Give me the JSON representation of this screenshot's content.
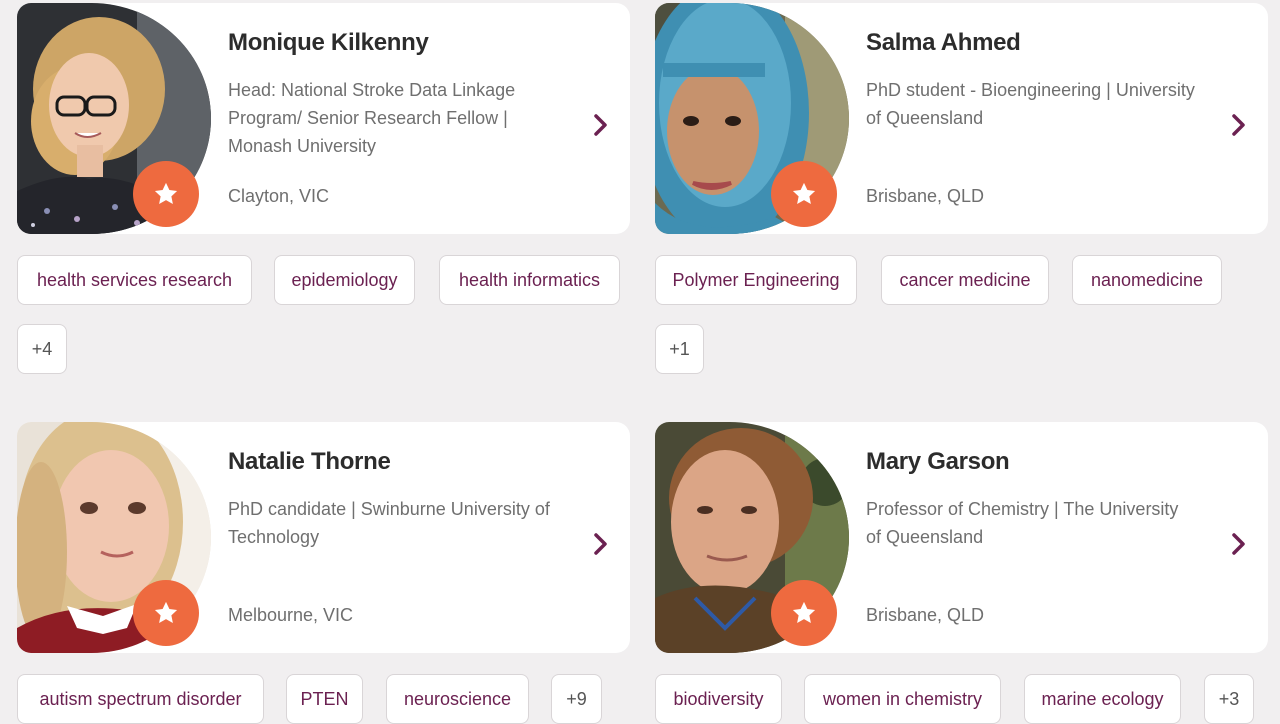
{
  "profiles": [
    {
      "name": "Monique Kilkenny",
      "role": "Head: National Stroke Data Linkage Program/ Senior Research Fellow | Monash University",
      "location": "Clayton, VIC",
      "tags": [
        "health services research",
        "epidemiology",
        "health informatics"
      ],
      "more": "+4"
    },
    {
      "name": "Salma Ahmed",
      "role": "PhD student - Bioengineering | University of Queensland",
      "location": "Brisbane, QLD",
      "tags": [
        "Polymer Engineering",
        "cancer medicine",
        "nanomedicine"
      ],
      "more": "+1"
    },
    {
      "name": "Natalie Thorne",
      "role": "PhD candidate | Swinburne University of Technology",
      "location": "Melbourne, VIC",
      "tags": [
        "autism spectrum disorder",
        "PTEN",
        "neuroscience"
      ],
      "more": "+9"
    },
    {
      "name": "Mary Garson",
      "role": "Professor of Chemistry | The University of Queensland",
      "location": "Brisbane, QLD",
      "tags": [
        "biodiversity",
        "women in chemistry",
        "marine ecology"
      ],
      "more": "+3"
    }
  ],
  "icons": {
    "badge": "star-icon",
    "arrow": "chevron-right-icon"
  },
  "colors": {
    "background": "#f1eff0",
    "card": "#ffffff",
    "badge": "#ee6a3f",
    "tag_text": "#6b2151",
    "chevron": "#6b2151",
    "name": "#2c2c2c",
    "secondary_text": "#6f6f6f"
  }
}
